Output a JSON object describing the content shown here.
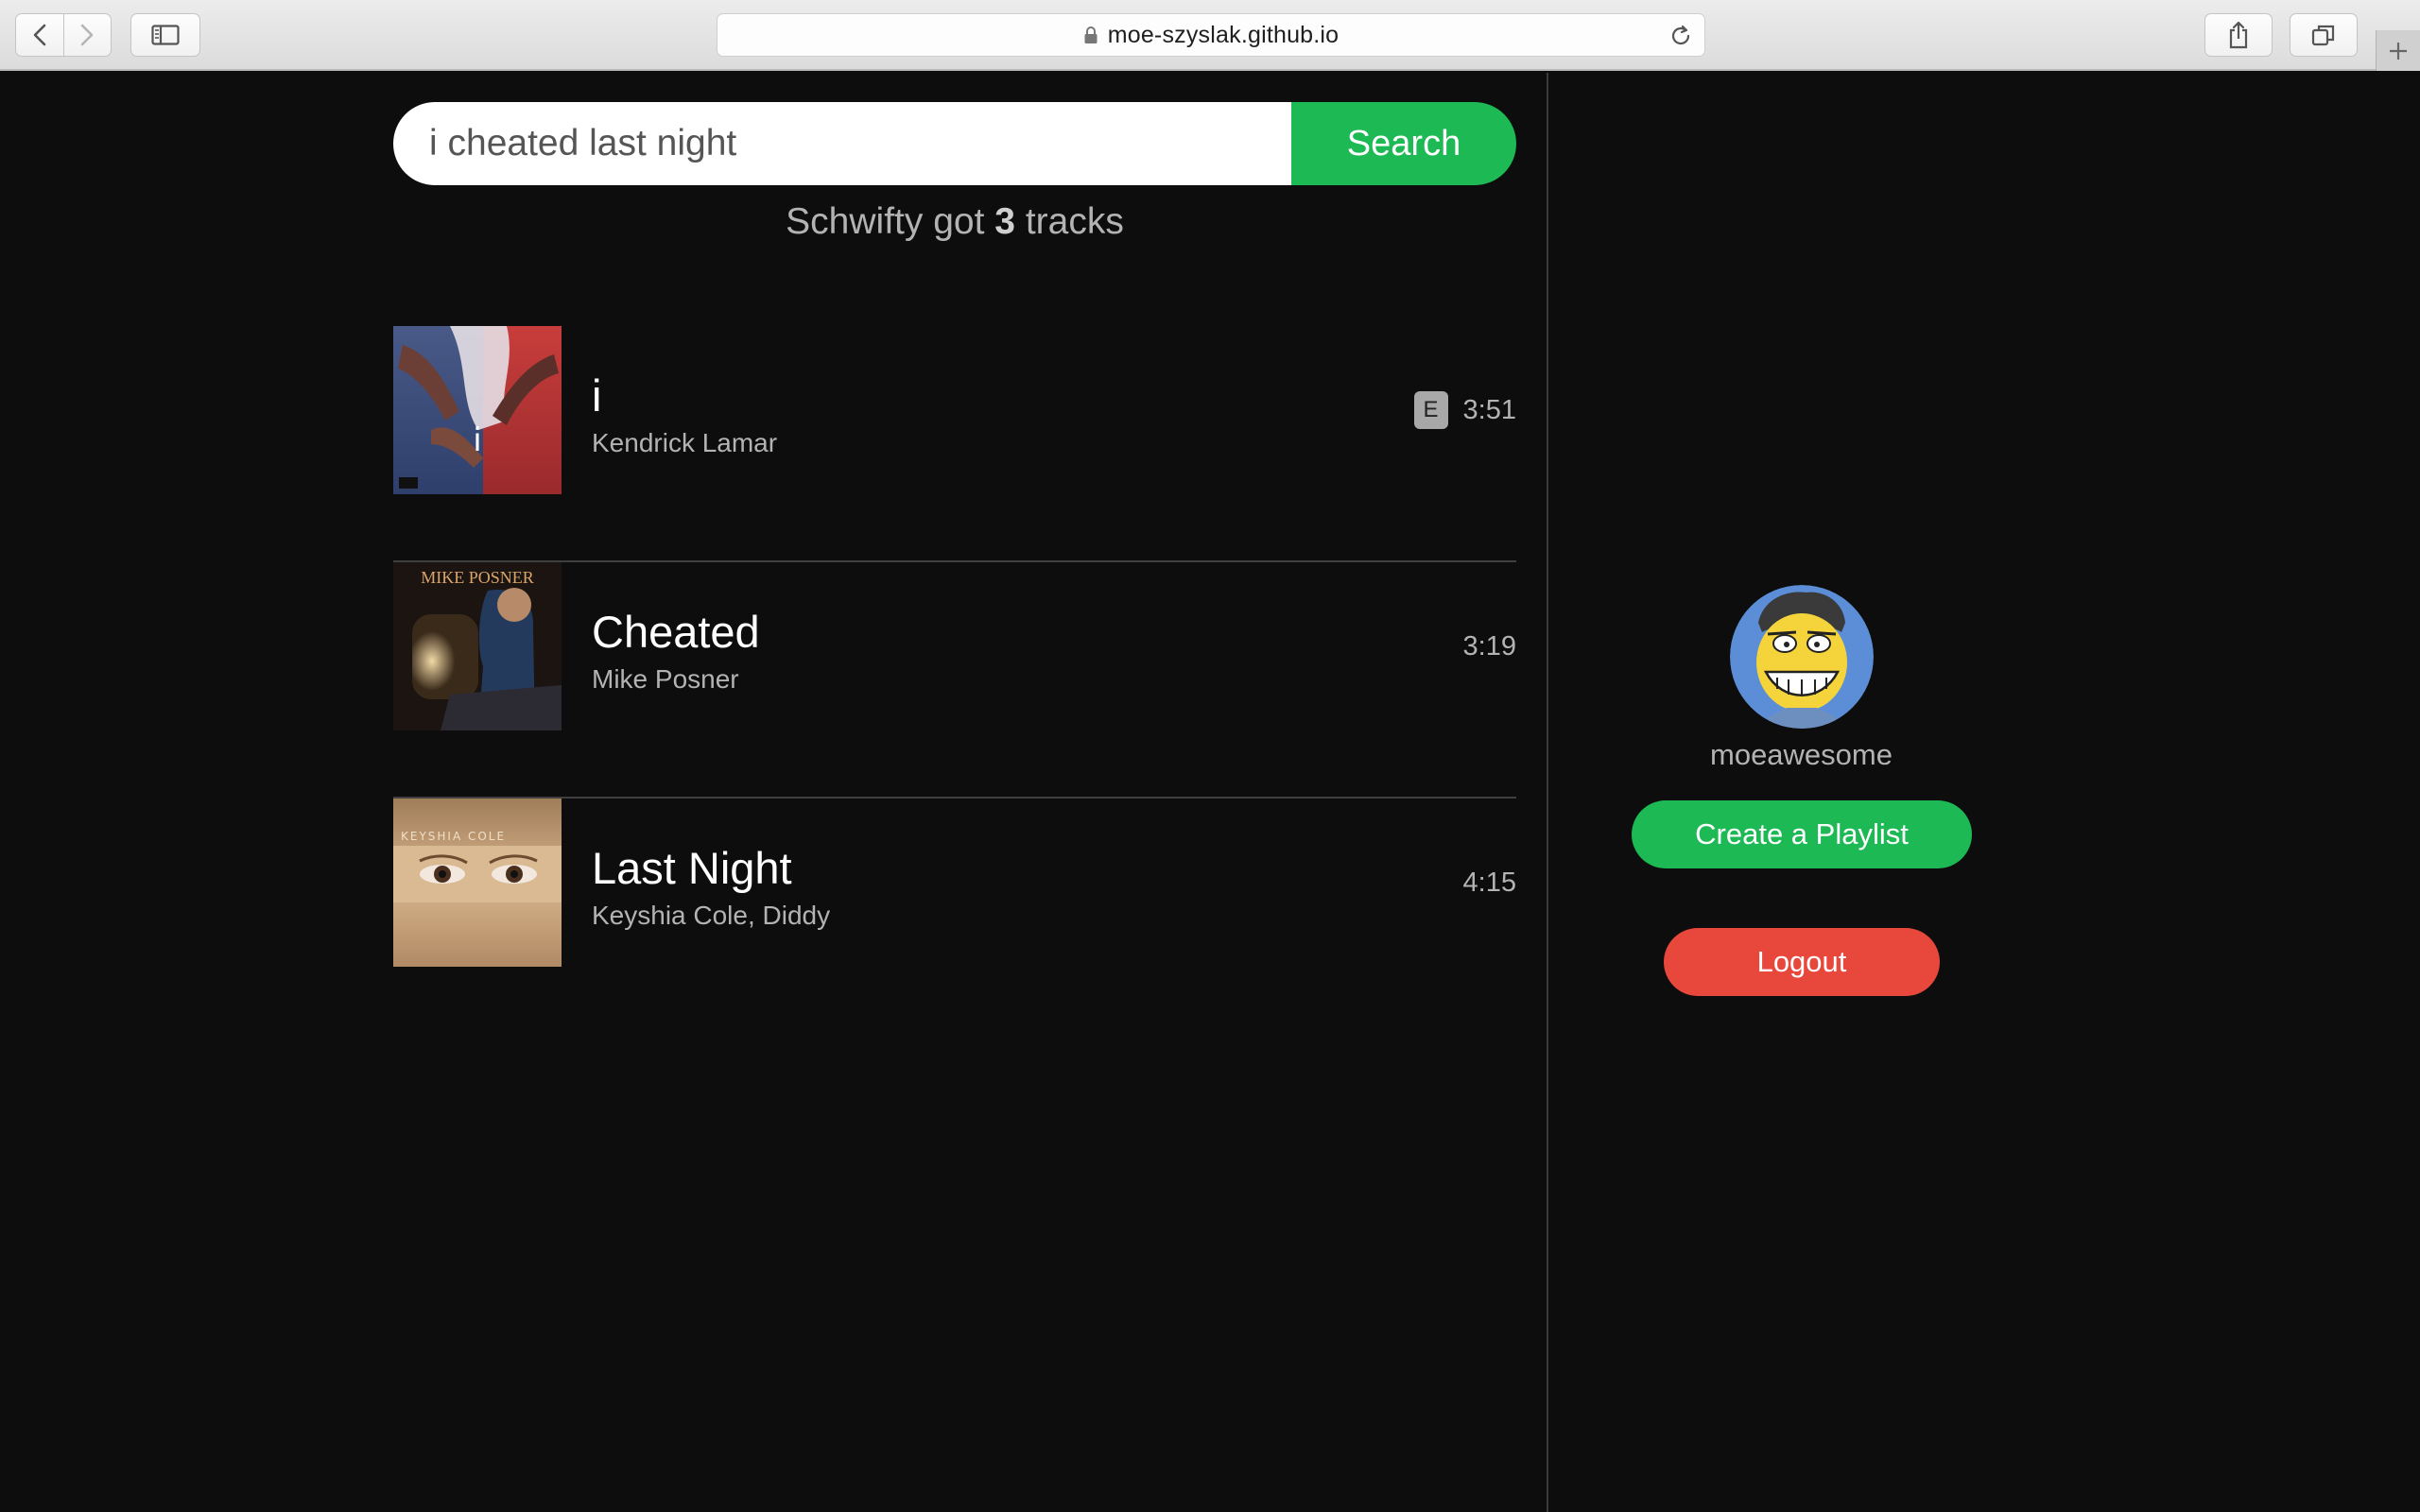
{
  "browser": {
    "url": "moe-szyslak.github.io"
  },
  "search": {
    "value": "i cheated last night",
    "button_label": "Search"
  },
  "summary": {
    "prefix": "Schwifty got",
    "count": "3",
    "suffix": "tracks"
  },
  "tracks": [
    {
      "title": "i",
      "artist": "Kendrick Lamar",
      "explicit": true,
      "explicit_label": "E",
      "duration": "3:51"
    },
    {
      "title": "Cheated",
      "artist": "Mike Posner",
      "explicit": false,
      "cover_text": "MIKE POSNER",
      "duration": "3:19"
    },
    {
      "title": "Last Night",
      "artist": "Keyshia Cole, Diddy",
      "explicit": false,
      "cover_text": "KEYSHIA COLE",
      "duration": "4:15"
    }
  ],
  "profile": {
    "username": "moeawesome",
    "create_playlist_label": "Create a Playlist",
    "logout_label": "Logout"
  },
  "colors": {
    "background": "#0d0d0d",
    "accent_green": "#1db954",
    "logout_red": "#e8473c",
    "muted_text": "#b3b3b3"
  }
}
